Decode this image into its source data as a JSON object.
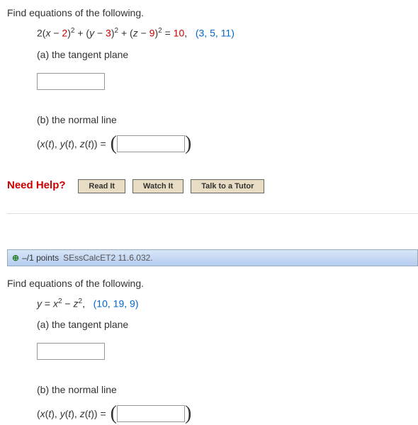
{
  "q1": {
    "prompt": "Find equations of the following.",
    "eq_plain_pre": "2(",
    "eq_var_x": "x",
    "eq_minus": " − ",
    "eq_two": "2",
    "eq_close_sq_plus": ")",
    "eq_plus": " + (",
    "eq_var_y": "y",
    "eq_three": "3",
    "eq_close_sq_plus2": ")",
    "eq_plus2": " + (",
    "eq_var_z": "z",
    "eq_nine": "9",
    "eq_close_eq": ")",
    "eq_equals": " = ",
    "eq_ten": "10",
    "eq_comma_space": ",   ",
    "pt_open": "(",
    "pt_a": "3",
    "pt_b": "5",
    "pt_c": "11",
    "pt_sep": ", ",
    "pt_close": ")",
    "part_a": "(a) the tangent plane",
    "part_b": "(b) the normal line",
    "tuple_open": "(",
    "tuple_x": "x",
    "tuple_t": "t",
    "tuple_mid1": "), ",
    "tuple_y": "y",
    "tuple_mid2": "), ",
    "tuple_z": "z",
    "tuple_end": "))",
    "tuple_eq": "  =  "
  },
  "help": {
    "label": "Need Help?",
    "read": "Read It",
    "watch": "Watch It",
    "tutor": "Talk to a Tutor"
  },
  "q2header": {
    "points": "–/1 points",
    "source": "SEssCalcET2 11.6.032."
  },
  "q2": {
    "prompt": "Find equations of the following.",
    "eq_y": "y",
    "eq_eq": " = ",
    "eq_x": "x",
    "eq_minus": " − ",
    "eq_z": "z",
    "eq_comma": ",   ",
    "pt_open": "(",
    "pt_a": "10",
    "pt_b": "19",
    "pt_c": "9",
    "pt_sep": ", ",
    "pt_close": ")",
    "part_a": "(a) the tangent plane",
    "part_b": "(b) the normal line",
    "tuple_open": "(",
    "tuple_x": "x",
    "tuple_t": "t",
    "tuple_mid1": "), ",
    "tuple_y": "y",
    "tuple_mid2": "), ",
    "tuple_z": "z",
    "tuple_end": "))",
    "tuple_eq": "  =  "
  }
}
